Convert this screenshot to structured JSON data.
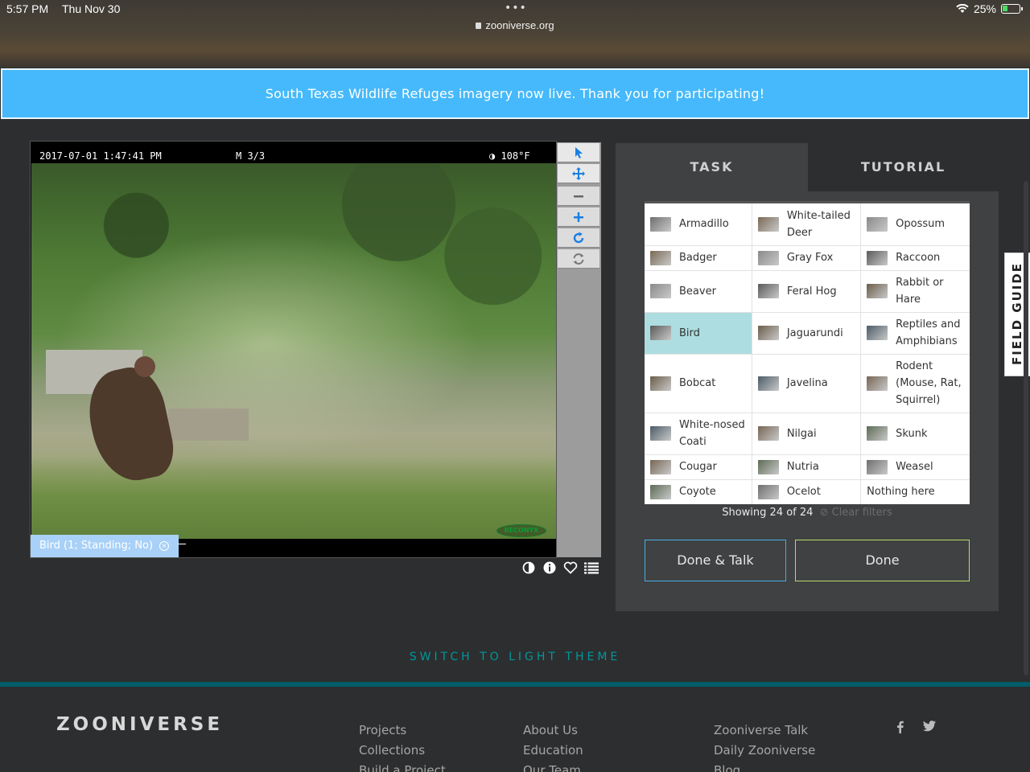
{
  "status_bar": {
    "time": "5:57 PM",
    "date": "Thu Nov 30",
    "dots": "•••",
    "url": "zooniverse.org",
    "battery": "25%"
  },
  "banner": {
    "text": "South Texas Wildlife Refuges imagery now live. Thank you for participating!"
  },
  "viewer": {
    "camera_timestamp": "2017-07-01 1:47:41 PM",
    "camera_frame": "M 3/3",
    "camera_temp": "◑ 108°F",
    "camera_brand": "RECONYX",
    "mark_label": "Bird (1; Standing; No)",
    "mark_close": "×",
    "tools": [
      "pointer-icon",
      "pan-icon",
      "zoom-out-icon",
      "zoom-in-icon",
      "rotate-icon",
      "reset-icon"
    ],
    "actions": [
      "invert-icon",
      "info-icon",
      "favorite-icon",
      "collection-icon"
    ]
  },
  "task_panel": {
    "tabs": {
      "task": "TASK",
      "tutorial": "TUTORIAL"
    },
    "choices": [
      [
        "Armadillo",
        "White-tailed Deer",
        "Opossum"
      ],
      [
        "Badger",
        "Gray Fox",
        "Raccoon"
      ],
      [
        "Beaver",
        "Feral Hog",
        "Rabbit or Hare"
      ],
      [
        "Bird",
        "Jaguarundi",
        "Reptiles and Amphibians"
      ],
      [
        "Bobcat",
        "Javelina",
        "Rodent (Mouse, Rat, Squirrel)"
      ],
      [
        "White-nosed Coati",
        "Nilgai",
        "Skunk"
      ],
      [
        "Cougar",
        "Nutria",
        "Weasel"
      ],
      [
        "Coyote",
        "Ocelot",
        "Nothing here"
      ]
    ],
    "selected": "Bird",
    "showing": "Showing 24 of 24",
    "clear_filters": "⊘ Clear filters",
    "done_talk": "Done & Talk",
    "done": "Done",
    "colors": {
      "talk_border": "#45aee8",
      "done_border": "#b8d96b",
      "selected_bg": "#addde0"
    }
  },
  "field_guide": "FIELD GUIDE",
  "theme_switch": "SWITCH TO LIGHT THEME",
  "footer": {
    "brand": "ZOONIVERSE",
    "col1": [
      "Projects",
      "Collections",
      "Build a Project"
    ],
    "col2": [
      "About Us",
      "Education",
      "Our Team"
    ],
    "col3": [
      "Zooniverse Talk",
      "Daily Zooniverse",
      "Blog"
    ],
    "social": [
      "facebook-icon",
      "twitter-icon"
    ]
  }
}
